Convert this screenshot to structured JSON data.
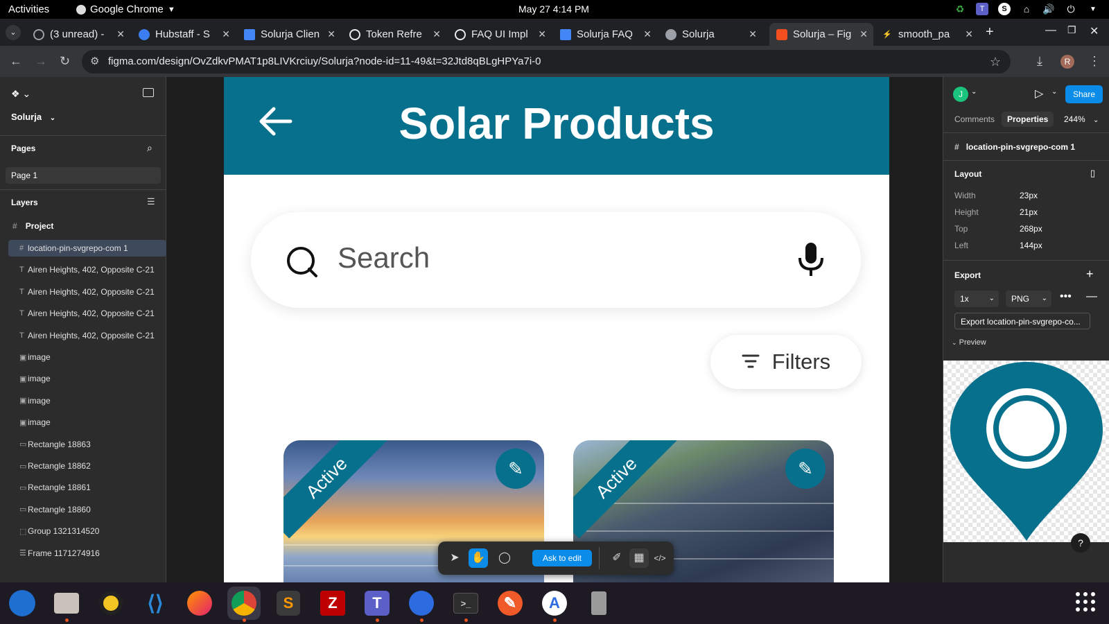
{
  "topbar": {
    "activities": "Activities",
    "app_name": "Google Chrome",
    "clock": "May 27  4:14 PM"
  },
  "tabs": [
    {
      "label": "(3 unread) -",
      "icon": "mail-icon",
      "color": "#9aa0a6"
    },
    {
      "label": "Hubstaff - S",
      "icon": "hubstaff-icon",
      "color": "#3b7cf0"
    },
    {
      "label": "Solurja Clien",
      "icon": "docs-icon",
      "color": "#4285f4"
    },
    {
      "label": "Token Refre",
      "icon": "openai-icon",
      "color": "#e8eaed"
    },
    {
      "label": "FAQ UI Impl",
      "icon": "openai-icon",
      "color": "#e8eaed"
    },
    {
      "label": "Solurja FAQ",
      "icon": "docs-icon",
      "color": "#4285f4"
    },
    {
      "label": "Solurja",
      "icon": "globe-icon",
      "color": "#9aa0a6"
    },
    {
      "label": "Solurja – Fig",
      "icon": "figma-icon",
      "color": "#f24e1e"
    },
    {
      "label": "smooth_pa",
      "icon": "lightning-icon",
      "color": "#4ea1f3"
    }
  ],
  "omnibox": {
    "url": "figma.com/design/OvZdkvPMAT1p8LIVKrciuy/Solurja?node-id=11-49&t=32Jtd8qBLgHPYa7i-0"
  },
  "profile_initial": "R",
  "left_panel": {
    "file_name": "Solurja",
    "pages_title": "Pages",
    "page_item": "Page 1",
    "layers_title": "Layers",
    "project": "Project",
    "layers": [
      {
        "icon": "#",
        "label": "location-pin-svgrepo-com 1",
        "selected": true
      },
      {
        "icon": "T",
        "label": "Airen Heights, 402, Opposite C-21"
      },
      {
        "icon": "T",
        "label": "Airen Heights, 402, Opposite C-21"
      },
      {
        "icon": "T",
        "label": "Airen Heights, 402, Opposite C-21"
      },
      {
        "icon": "T",
        "label": "Airen Heights, 402, Opposite C-21"
      },
      {
        "icon": "▣",
        "label": "image"
      },
      {
        "icon": "▣",
        "label": "image"
      },
      {
        "icon": "▣",
        "label": "image"
      },
      {
        "icon": "▣",
        "label": "image"
      },
      {
        "icon": "▭",
        "label": "Rectangle 18863"
      },
      {
        "icon": "▭",
        "label": "Rectangle 18862"
      },
      {
        "icon": "▭",
        "label": "Rectangle 18861"
      },
      {
        "icon": "▭",
        "label": "Rectangle 18860"
      },
      {
        "icon": "⬚",
        "label": "Group 1321314520"
      },
      {
        "icon": "☰",
        "label": "Frame 1171274916"
      }
    ]
  },
  "design": {
    "title": "Solar Products",
    "search_placeholder": "Search",
    "filters_label": "Filters",
    "cards": [
      {
        "badge": "Active"
      },
      {
        "badge": "Active"
      }
    ],
    "brand_color": "#07708c"
  },
  "floating_toolbar": {
    "ask_label": "Ask to edit"
  },
  "right_panel": {
    "user_initial": "J",
    "share_label": "Share",
    "tab_comments": "Comments",
    "tab_properties": "Properties",
    "zoom": "244%",
    "selection_name": "location-pin-svgrepo-com 1",
    "layout_title": "Layout",
    "layout": [
      {
        "label": "Width",
        "value": "23px"
      },
      {
        "label": "Height",
        "value": "21px"
      },
      {
        "label": "Top",
        "value": "268px"
      },
      {
        "label": "Left",
        "value": "144px"
      }
    ],
    "export_title": "Export",
    "export_scale": "1x",
    "export_format": "PNG",
    "export_button": "Export location-pin-svgrepo-co...",
    "preview_label": "Preview",
    "help": "?"
  }
}
